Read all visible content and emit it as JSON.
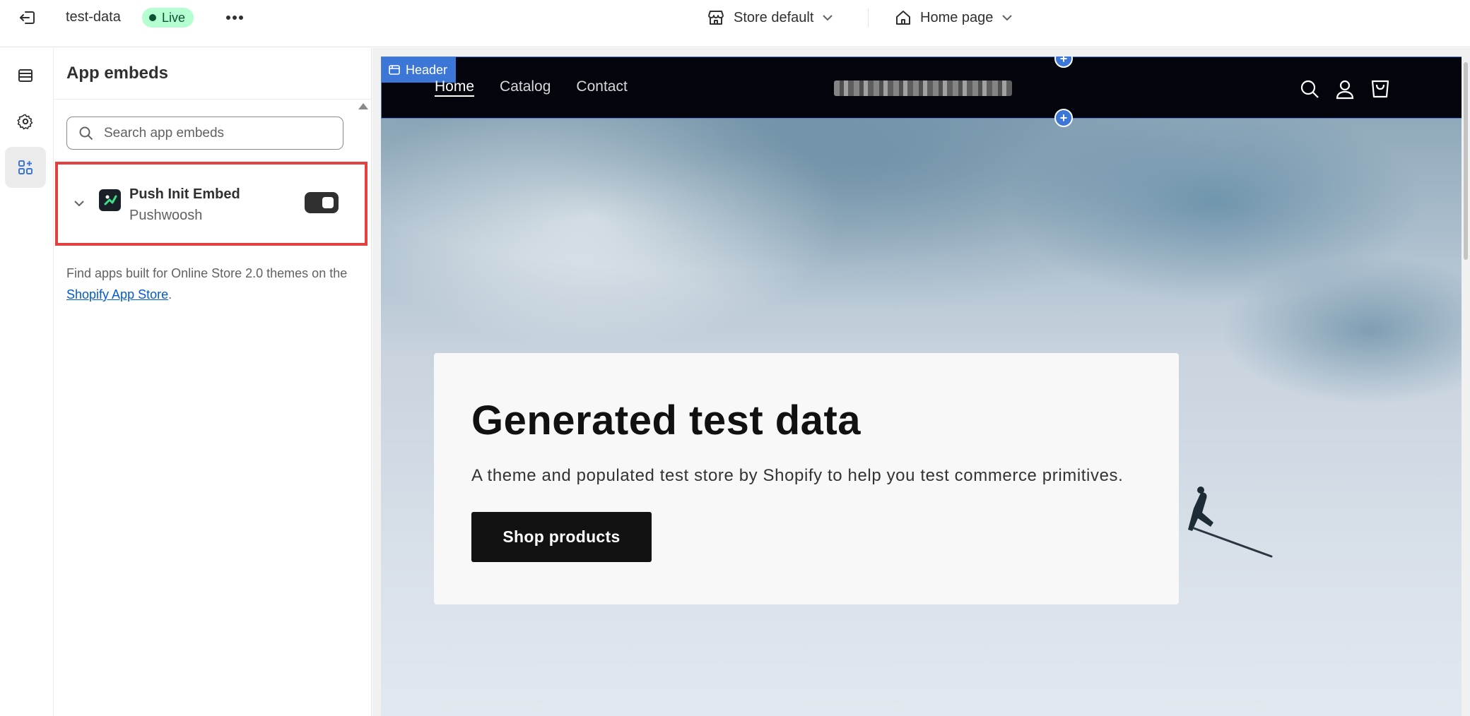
{
  "topbar": {
    "store_name": "test-data",
    "status": "Live",
    "store_selector": "Store default",
    "page_selector": "Home page"
  },
  "panel": {
    "title": "App embeds",
    "search_placeholder": "Search app embeds",
    "embeds": [
      {
        "name": "Push Init Embed",
        "provider": "Pushwoosh",
        "enabled": true
      }
    ],
    "help_prefix": "Find apps built for Online Store 2.0 themes on the ",
    "help_link": "Shopify App Store",
    "help_suffix": "."
  },
  "preview": {
    "section_tag": "Header",
    "nav": [
      "Home",
      "Catalog",
      "Contact"
    ],
    "hero": {
      "title": "Generated test data",
      "subtitle": "A theme and populated test store by Shopify to help you test commerce primitives.",
      "button": "Shop products"
    },
    "add_section_symbol": "+"
  },
  "colors": {
    "live_bg": "#b4fed2",
    "live_text": "#0c5132",
    "highlight": "#e24141",
    "section_accent": "#3c76d6",
    "header_bg": "#03040c"
  }
}
